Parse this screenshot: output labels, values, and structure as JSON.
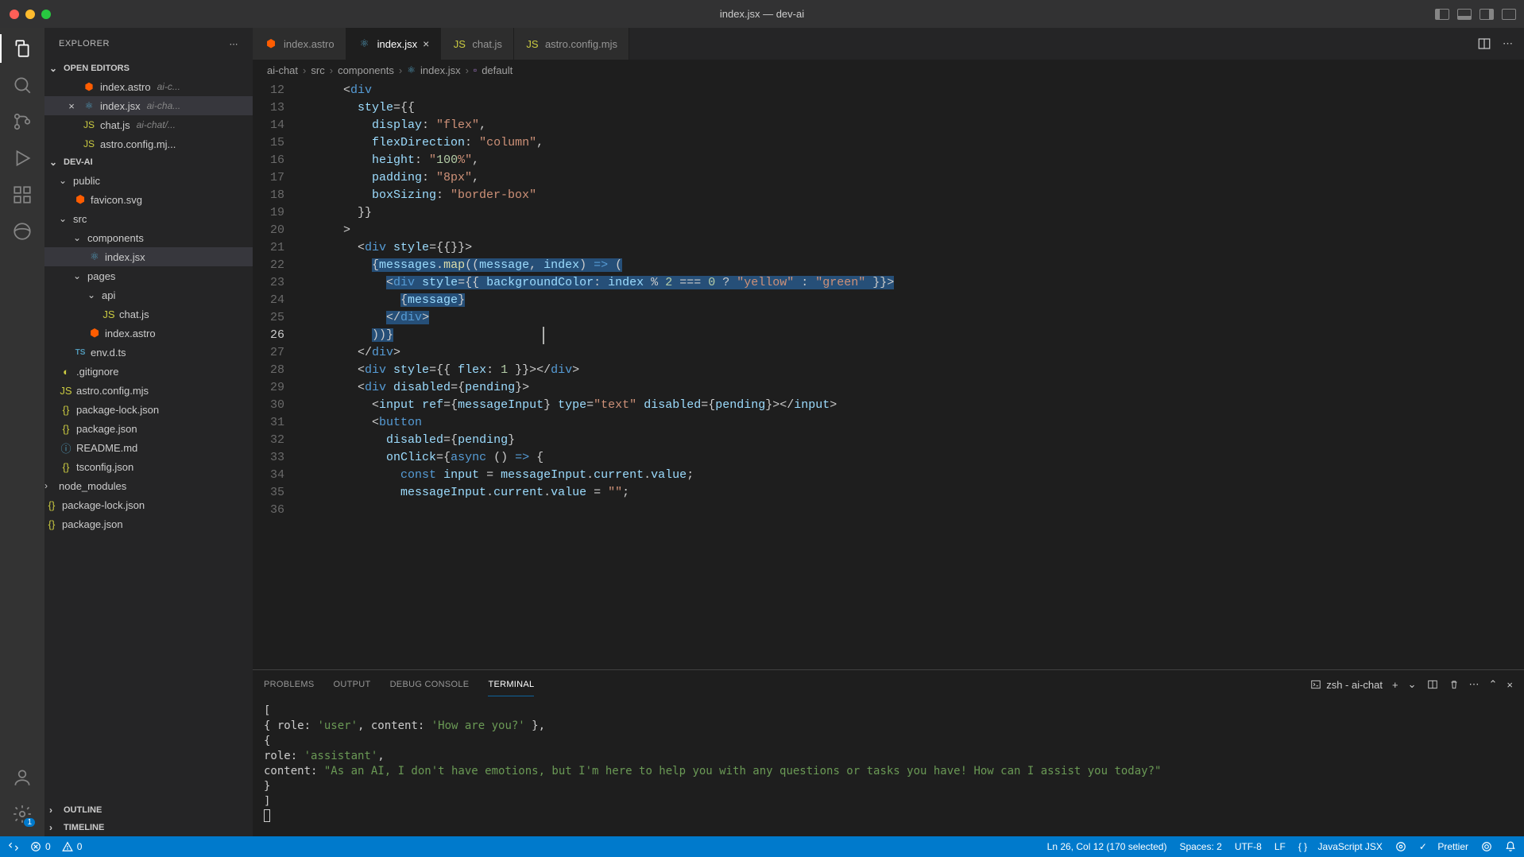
{
  "window": {
    "title": "index.jsx — dev-ai"
  },
  "sidebar": {
    "title": "EXPLORER",
    "sections": {
      "openEditors": "OPEN EDITORS",
      "project": "DEV-AI",
      "outline": "OUTLINE",
      "timeline": "TIMELINE"
    },
    "openEditors": [
      {
        "name": "index.astro",
        "hint": "ai-c...",
        "icon": "astro"
      },
      {
        "name": "index.jsx",
        "hint": "ai-cha...",
        "icon": "jsx",
        "active": true,
        "closable": true
      },
      {
        "name": "chat.js",
        "hint": "ai-chat/...",
        "icon": "js"
      },
      {
        "name": "astro.config.mj...",
        "hint": "",
        "icon": "js"
      }
    ],
    "tree": [
      {
        "label": "public",
        "type": "folder",
        "indent": 1,
        "open": true
      },
      {
        "label": "favicon.svg",
        "type": "file",
        "indent": 2,
        "icon": "astro"
      },
      {
        "label": "src",
        "type": "folder",
        "indent": 1,
        "open": true
      },
      {
        "label": "components",
        "type": "folder",
        "indent": 2,
        "open": true
      },
      {
        "label": "index.jsx",
        "type": "file",
        "indent": 3,
        "icon": "jsx",
        "selected": true
      },
      {
        "label": "pages",
        "type": "folder",
        "indent": 2,
        "open": true
      },
      {
        "label": "api",
        "type": "folder",
        "indent": 3,
        "open": true
      },
      {
        "label": "chat.js",
        "type": "file",
        "indent": 4,
        "icon": "js"
      },
      {
        "label": "index.astro",
        "type": "file",
        "indent": 3,
        "icon": "astro"
      },
      {
        "label": "env.d.ts",
        "type": "file",
        "indent": 2,
        "icon": "ts"
      },
      {
        "label": ".gitignore",
        "type": "file",
        "indent": 1,
        "icon": "git"
      },
      {
        "label": "astro.config.mjs",
        "type": "file",
        "indent": 1,
        "icon": "js"
      },
      {
        "label": "package-lock.json",
        "type": "file",
        "indent": 1,
        "icon": "json"
      },
      {
        "label": "package.json",
        "type": "file",
        "indent": 1,
        "icon": "json"
      },
      {
        "label": "README.md",
        "type": "file",
        "indent": 1,
        "icon": "md"
      },
      {
        "label": "tsconfig.json",
        "type": "file",
        "indent": 1,
        "icon": "json"
      },
      {
        "label": "node_modules",
        "type": "folder",
        "indent": 0,
        "open": false
      },
      {
        "label": "package-lock.json",
        "type": "file",
        "indent": 0,
        "icon": "json"
      },
      {
        "label": "package.json",
        "type": "file",
        "indent": 0,
        "icon": "json"
      }
    ]
  },
  "tabs": [
    {
      "label": "index.astro",
      "icon": "astro"
    },
    {
      "label": "index.jsx",
      "icon": "jsx",
      "active": true,
      "close": true
    },
    {
      "label": "chat.js",
      "icon": "js"
    },
    {
      "label": "astro.config.mjs",
      "icon": "js"
    }
  ],
  "breadcrumb": [
    "ai-chat",
    "src",
    "components",
    "index.jsx",
    "default"
  ],
  "code": {
    "startLine": 12,
    "currentLine": 26,
    "lines": [
      "      <div",
      "        style={{",
      "          display: \"flex\",",
      "          flexDirection: \"column\",",
      "          height: \"100%\",",
      "          padding: \"8px\",",
      "          boxSizing: \"border-box\"",
      "        }}",
      "      >",
      "        <div style={{}}>",
      "          {messages.map((message, index) => (",
      "            <div style={{ backgroundColor: index % 2 === 0 ? \"yellow\" : \"green\" }}>",
      "              {message}",
      "            </div>",
      "          ))}",
      "        </div>",
      "        <div style={{ flex: 1 }}></div>",
      "        <div disabled={pending}>",
      "          <input ref={messageInput} type=\"text\" disabled={pending}></input>",
      "          <button",
      "            disabled={pending}",
      "            onClick={async () => {",
      "              const input = messageInput.current.value;",
      "              messageInput.current.value = \"\";",
      ""
    ],
    "selection": {
      "fromLine": 22,
      "toLine": 26
    }
  },
  "panel": {
    "tabs": [
      "PROBLEMS",
      "OUTPUT",
      "DEBUG CONSOLE",
      "TERMINAL"
    ],
    "activeTab": 3,
    "terminalLabel": "zsh - ai-chat",
    "terminal": [
      "[",
      "  { role: 'user', content: 'How are you?' },",
      "  {",
      "    role: 'assistant',",
      "    content: \"As an AI, I don't have emotions, but I'm here to help you with any questions or tasks you have! How can I assist you today?\"",
      "  }",
      "]",
      "▯"
    ]
  },
  "statusbar": {
    "errors": "0",
    "warnings": "0",
    "position": "Ln 26, Col 12 (170 selected)",
    "spaces": "Spaces: 2",
    "encoding": "UTF-8",
    "eol": "LF",
    "lang": "JavaScript JSX",
    "prettier": "Prettier",
    "liveshare": "",
    "bell": ""
  }
}
